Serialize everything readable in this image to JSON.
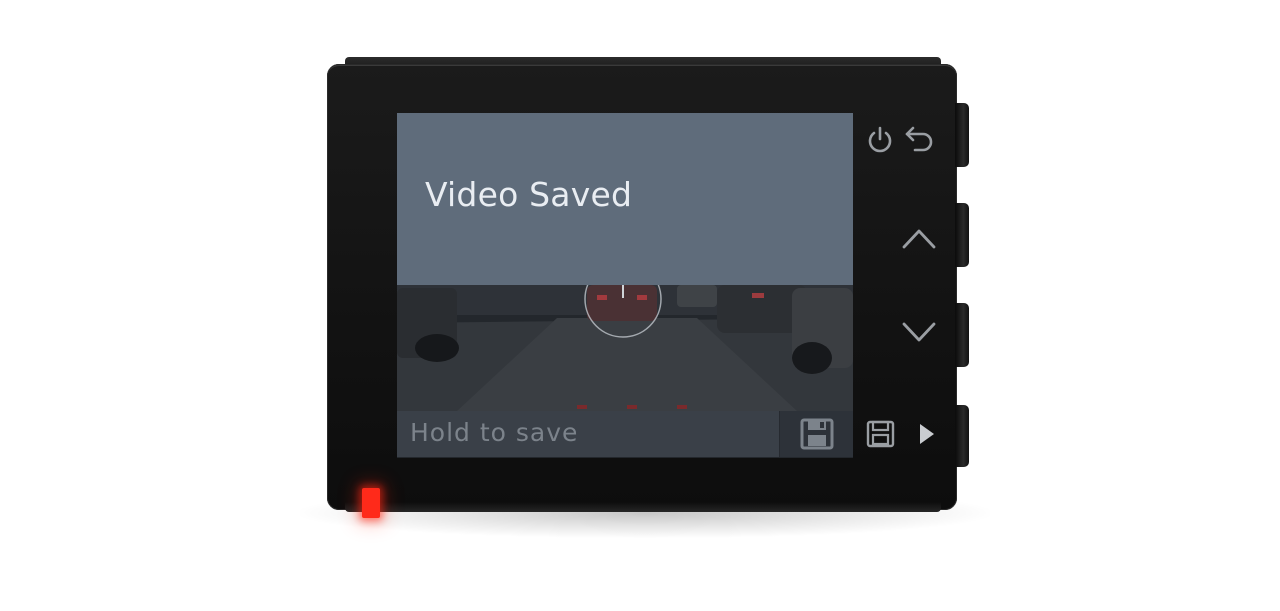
{
  "screen": {
    "notice_text": "Video Saved",
    "save_bar": {
      "label": "Hold to save",
      "button_icon": "save-icon"
    }
  },
  "hardware_labels": [
    {
      "name": "power-icon"
    },
    {
      "name": "back-icon"
    },
    {
      "name": "chevron-up-icon"
    },
    {
      "name": "chevron-down-icon"
    },
    {
      "name": "save-icon"
    },
    {
      "name": "play-icon"
    }
  ],
  "colors": {
    "notice_background": "#5f6c7b",
    "notice_text": "#e9edf2",
    "save_bar_background": "#3a4048",
    "led": "#ff2a1a"
  }
}
